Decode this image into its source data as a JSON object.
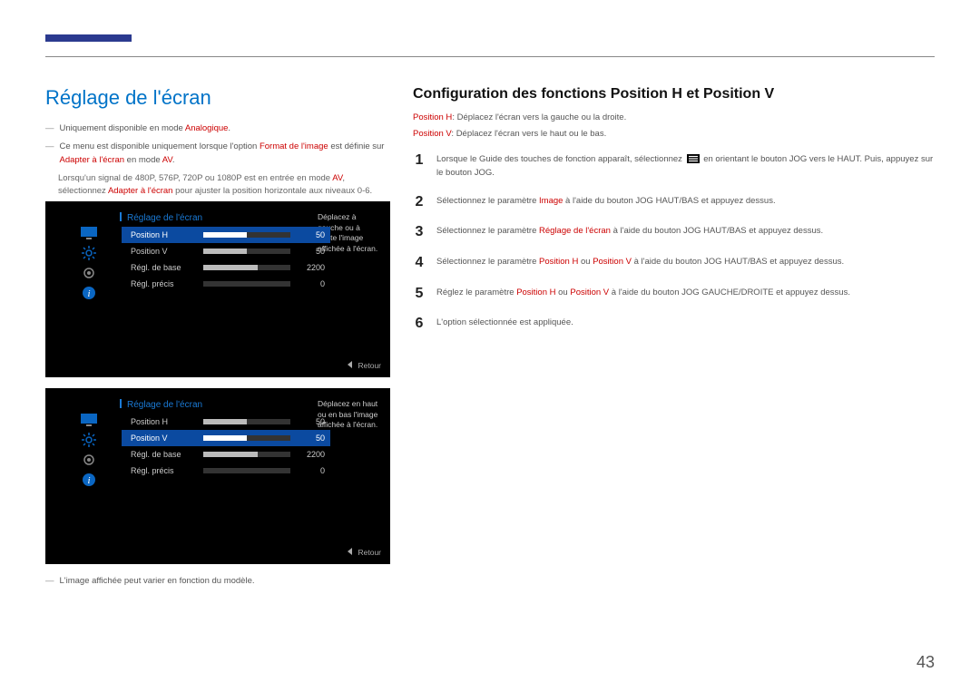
{
  "page_number": "43",
  "left_title": "Réglage de l'écran",
  "note1_pre": "Uniquement disponible en mode ",
  "note1_em": "Analogique",
  "note1_post": ".",
  "note2_pre": "Ce menu est disponible uniquement lorsque l'option ",
  "note2_em1": "Format de l'image",
  "note2_mid": " est définie sur ",
  "note2_em2": "Adapter à l'écran",
  "note2_mid2": " en mode ",
  "note2_em3": "AV",
  "note2_post": ".",
  "sub1_pre": "Lorsqu'un signal de 480P, 576P, 720P ou 1080P est en entrée en mode ",
  "sub1_em1": "AV",
  "sub1_mid": ", sélectionnez ",
  "sub1_em2": "Adapter à l'écran",
  "sub1_post": " pour ajuster la position horizontale aux niveaux 0-6.",
  "osd1": {
    "title": "Réglage de l'écran",
    "help": "Déplacez à gauche ou à droite l'image affichée à l'écran.",
    "items": [
      {
        "label": "Position H",
        "value": "50",
        "fill": 50,
        "selected": true
      },
      {
        "label": "Position V",
        "value": "50",
        "fill": 50,
        "selected": false
      },
      {
        "label": "Régl. de base",
        "value": "2200",
        "fill": 62,
        "selected": false
      },
      {
        "label": "Régl. précis",
        "value": "0",
        "fill": 0,
        "selected": false
      }
    ],
    "back": "Retour"
  },
  "osd2": {
    "title": "Réglage de l'écran",
    "help": "Déplacez en haut ou en bas l'image affichée à l'écran.",
    "items": [
      {
        "label": "Position H",
        "value": "50",
        "fill": 50,
        "selected": false
      },
      {
        "label": "Position V",
        "value": "50",
        "fill": 50,
        "selected": true
      },
      {
        "label": "Régl. de base",
        "value": "2200",
        "fill": 62,
        "selected": false
      },
      {
        "label": "Régl. précis",
        "value": "0",
        "fill": 0,
        "selected": false
      }
    ],
    "back": "Retour"
  },
  "footnote": "L'image affichée peut varier en fonction du modèle.",
  "r_title": "Configuration des fonctions Position H et Position V",
  "def_h_label": "Position H",
  "def_h_text": ": Déplacez l'écran vers la gauche ou la droite.",
  "def_v_label": "Position V",
  "def_v_text": ": Déplacez l'écran vers le haut ou le bas.",
  "steps": [
    {
      "n": "1",
      "pre": "Lorsque le Guide des touches de fonction apparaît, sélectionnez ",
      "post": " en orientant le bouton JOG vers le HAUT. Puis, appuyez sur le bouton JOG.",
      "icon": true
    },
    {
      "n": "2",
      "pre": "Sélectionnez le paramètre ",
      "em1": "Image",
      "post": " à l'aide du bouton JOG HAUT/BAS et appuyez dessus."
    },
    {
      "n": "3",
      "pre": "Sélectionnez le paramètre ",
      "em1": "Réglage de l'écran",
      "post": " à l'aide du bouton JOG HAUT/BAS et appuyez dessus."
    },
    {
      "n": "4",
      "pre": "Sélectionnez le paramètre ",
      "em1": "Position H",
      "mid": " ou ",
      "em2": "Position V",
      "post": " à l'aide du bouton JOG HAUT/BAS et appuyez dessus."
    },
    {
      "n": "5",
      "pre": "Réglez le paramètre ",
      "em1": "Position H",
      "mid": " ou ",
      "em2": "Position V",
      "post": " à l'aide du bouton JOG GAUCHE/DROITE et appuyez dessus."
    },
    {
      "n": "6",
      "pre": "L'option sélectionnée est appliquée."
    }
  ],
  "icons": {
    "monitor": "monitor-icon",
    "sun": "brightness-icon",
    "gear": "settings-icon",
    "info": "info-icon"
  }
}
